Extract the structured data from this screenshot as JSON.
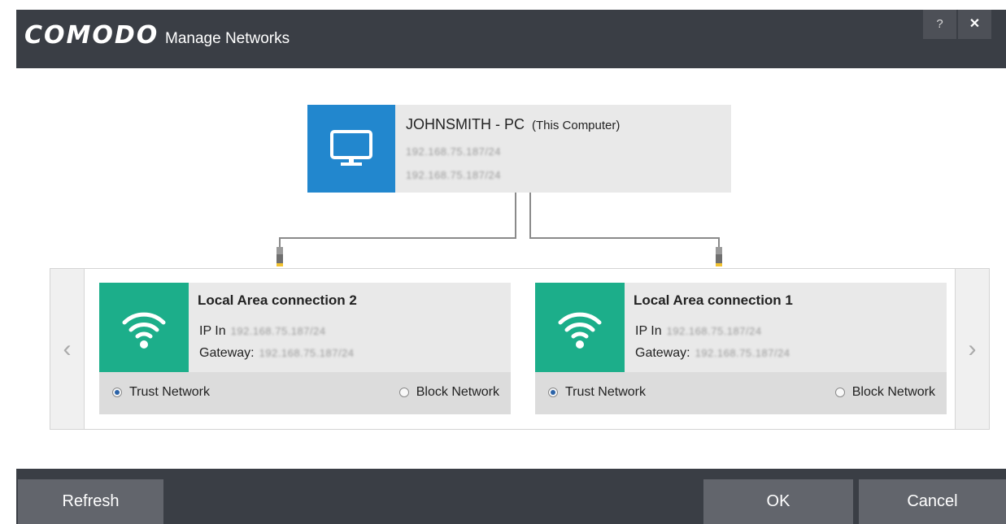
{
  "window": {
    "brand": "COMODO",
    "title": "Manage Networks",
    "help_label": "?",
    "close_label": "✕"
  },
  "computer": {
    "hostname": "JOHNSMITH - PC",
    "note": "(This Computer)",
    "ip_1": "192.168.75.187/24",
    "ip_2": "192.168.75.187/24",
    "icon": "monitor-icon"
  },
  "connections": [
    {
      "name": "Local Area connection 2",
      "ip_label": "IP In",
      "ip": "192.168.75.187/24",
      "gateway_label": "Gateway:",
      "gateway": "192.168.75.187/24",
      "icon": "wifi-icon",
      "trust_label": "Trust Network",
      "block_label": "Block Network",
      "selected": "trust"
    },
    {
      "name": "Local Area connection 1",
      "ip_label": "IP In",
      "ip": "192.168.75.187/24",
      "gateway_label": "Gateway:",
      "gateway": "192.168.75.187/24",
      "icon": "wifi-icon",
      "trust_label": "Trust Network",
      "block_label": "Block Network",
      "selected": "trust"
    }
  ],
  "nav": {
    "prev": "‹",
    "next": "›"
  },
  "footer": {
    "refresh_label": "Refresh",
    "ok_label": "OK",
    "cancel_label": "Cancel"
  },
  "colors": {
    "titlebar": "#3a3e45",
    "computer_accent": "#2287ce",
    "network_accent": "#1cae8a",
    "button": "#62656c"
  }
}
